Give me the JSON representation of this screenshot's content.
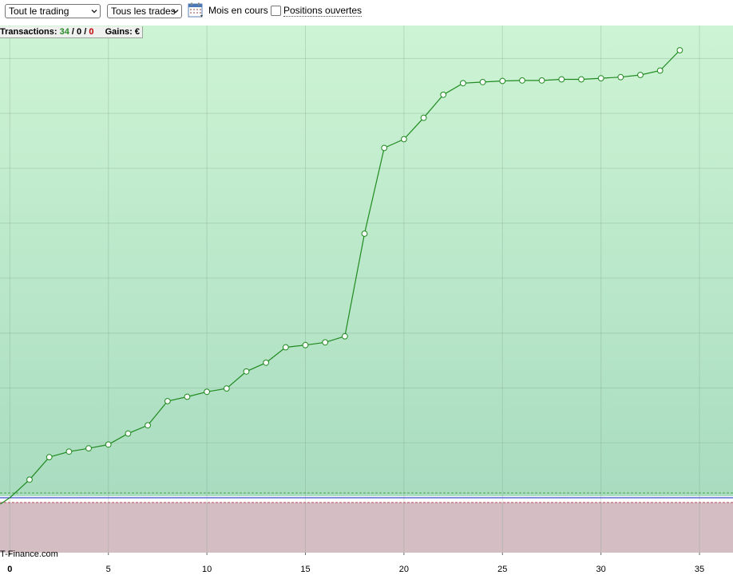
{
  "toolbar": {
    "scope_select": "Tout le trading",
    "trades_select": "Tous les trades",
    "period_label": "Mois en cours",
    "open_positions_label": "Positions ouvertes",
    "open_positions_checked": false
  },
  "stats": {
    "transactions_label": "Transactions:",
    "count_total": "34",
    "separator": "/",
    "count_mid": "0",
    "count_red": "0",
    "gains_label": "Gains:",
    "gains_value": "€"
  },
  "watermark": "T-Finance.com",
  "colors": {
    "line": "#1f8a1f",
    "gain_zone_top": "#cdf4d4",
    "gain_zone_bottom": "#a9dcc0",
    "loss_zone": "#d4bec4",
    "zero_line": "#3b4fd0",
    "upper_dash": "#4aa84a",
    "lower_dash": "#c04a60"
  },
  "chart_data": {
    "type": "line",
    "x": [
      0,
      1,
      2,
      3,
      4,
      5,
      6,
      7,
      8,
      9,
      10,
      11,
      12,
      13,
      14,
      15,
      16,
      17,
      18,
      19,
      20,
      21,
      22,
      23,
      24,
      25,
      26,
      27,
      28,
      29,
      30,
      31,
      32,
      33,
      34
    ],
    "series": [
      {
        "values": [
          0,
          3.3,
          7.4,
          8.4,
          9.0,
          9.7,
          11.7,
          13.2,
          17.6,
          18.4,
          19.3,
          19.9,
          23.0,
          24.6,
          27.4,
          27.8,
          28.3,
          29.4,
          48.1,
          63.7,
          65.3,
          69.2,
          73.4,
          75.5,
          75.7,
          75.9,
          76.0,
          76.0,
          76.2,
          76.2,
          76.4,
          76.6,
          77.0,
          77.8,
          81.5
        ]
      }
    ],
    "xticks": [
      0,
      5,
      10,
      15,
      20,
      25,
      30,
      35
    ],
    "xlim": [
      -0.5,
      36.7
    ],
    "ylim": [
      -10,
      86
    ],
    "marker": "open-circle",
    "grid": true
  }
}
